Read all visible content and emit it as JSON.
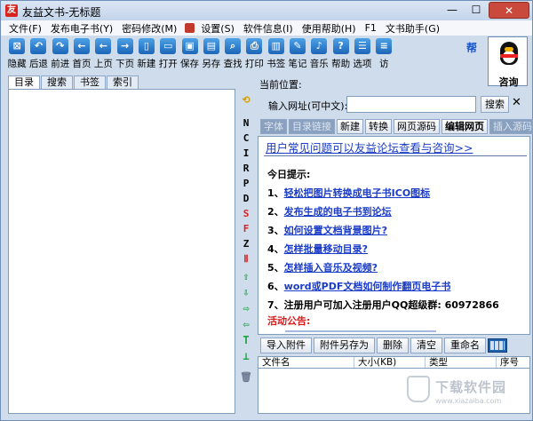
{
  "window": {
    "title": "友益文书-无标题",
    "minimize": "—",
    "maximize": "☐",
    "close": "✕"
  },
  "menu": [
    "文件(F)",
    "发布电子书(Y)",
    "密码修改(M)",
    "设置(S)",
    "软件信息(I)",
    "使用帮助(H)",
    "F1",
    "文书助手(G)"
  ],
  "toolbar": [
    {
      "label": "隐藏",
      "icon": "hide-icon",
      "glyph": "⊠"
    },
    {
      "label": "后退",
      "icon": "undo-icon",
      "glyph": "↶"
    },
    {
      "label": "前进",
      "icon": "redo-icon",
      "glyph": "↷"
    },
    {
      "label": "首页",
      "icon": "back-arrow-icon",
      "glyph": "←"
    },
    {
      "label": "上页",
      "icon": "left-arrow-icon",
      "glyph": "←"
    },
    {
      "label": "下页",
      "icon": "right-arrow-icon",
      "glyph": "→"
    },
    {
      "label": "新建",
      "icon": "new-file-icon",
      "glyph": "▯"
    },
    {
      "label": "打开",
      "icon": "open-folder-icon",
      "glyph": "▭"
    },
    {
      "label": "保存",
      "icon": "save-icon",
      "glyph": "▣"
    },
    {
      "label": "另存",
      "icon": "save-as-icon",
      "glyph": "▤"
    },
    {
      "label": "查找",
      "icon": "find-icon",
      "glyph": "⌕"
    },
    {
      "label": "打印",
      "icon": "print-icon",
      "glyph": "⎙"
    },
    {
      "label": "书签",
      "icon": "bookmark-icon",
      "glyph": "▥"
    },
    {
      "label": "笔记",
      "icon": "note-icon",
      "glyph": "✎"
    },
    {
      "label": "音乐",
      "icon": "music-icon",
      "glyph": "♪"
    },
    {
      "label": "帮助",
      "icon": "help-icon",
      "glyph": "?"
    },
    {
      "label": "选项",
      "icon": "options-icon",
      "glyph": "☰"
    },
    {
      "label": "访",
      "icon": "visit-icon",
      "glyph": "≡"
    }
  ],
  "qq": {
    "label": "咨询",
    "help_glyph": "帮"
  },
  "left_tabs": [
    "目录",
    "搜索",
    "书签",
    "索引"
  ],
  "side_letters": [
    "N",
    "C",
    "I",
    "R",
    "P",
    "D",
    "S",
    "F",
    "Z",
    "Ⅱ"
  ],
  "side_arrows": [
    "⇧",
    "⇩",
    "⇨",
    "⇦",
    "T",
    "⊥"
  ],
  "right": {
    "location_label": "当前位置:",
    "url_label": "输入网址(可中文):",
    "url_value": "",
    "search_button": "搜索",
    "close": "✕",
    "buttons": [
      "字体",
      "目录链接",
      "新建",
      "转换",
      "网页源码",
      "编辑网页",
      "插入源码"
    ],
    "headline": "用户常见问题可以友益论坛查看与咨询>>",
    "tips_title": "今日提示:",
    "tips": [
      {
        "num": "1、",
        "text": "轻松把图片转换成电子书ICO图标"
      },
      {
        "num": "2、",
        "text": "发布生成的电子书到论坛"
      },
      {
        "num": "3、",
        "text": "如何设置文档背景图片?"
      },
      {
        "num": "4、",
        "text": "怎样批量移动目录?"
      },
      {
        "num": "5、",
        "text": "怎样插入音乐及视频?"
      },
      {
        "num": "6、",
        "text": "word或PDF文档如何制作翻页电子书"
      },
      {
        "num": "7、",
        "text": "注册用户可加入注册用户QQ超级群: 60972866"
      }
    ],
    "events_title": "活动公告:",
    "attach_buttons": [
      "导入附件",
      "附件另存为",
      "删除",
      "清空",
      "重命名"
    ],
    "file_columns": [
      "文件名",
      "大小(KB)",
      "类型",
      "序号"
    ]
  },
  "watermark": {
    "text": "下载软件园",
    "url": "www.xiazaiba.com"
  },
  "colors": {
    "link": "#1a3cc8",
    "accent_red": "#d81b1b",
    "toolbar_icon": "#1c66b8"
  }
}
